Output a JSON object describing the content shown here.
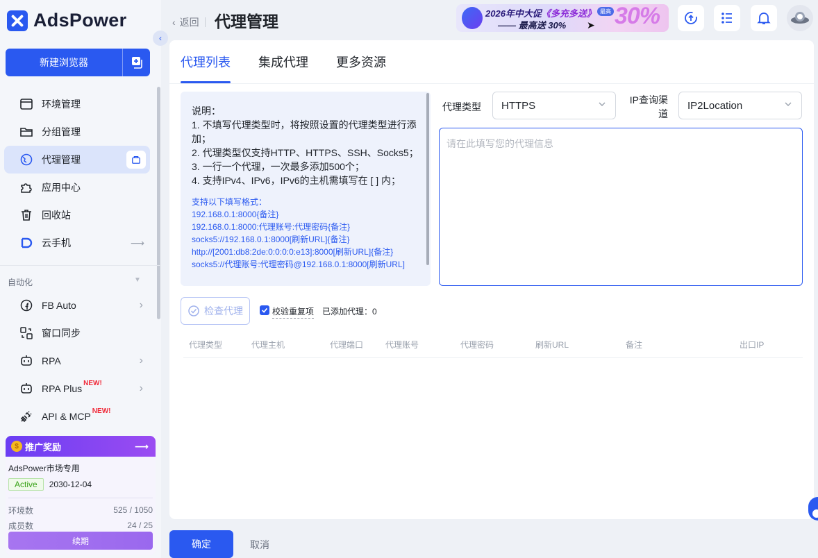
{
  "app": {
    "name": "AdsPower"
  },
  "sidebar": {
    "new_browser": "新建浏览器",
    "items": [
      {
        "label": "环境管理",
        "icon": "browser-window-icon"
      },
      {
        "label": "分组管理",
        "icon": "folder-icon"
      },
      {
        "label": "代理管理",
        "icon": "proxy-globe-icon",
        "active": true
      },
      {
        "label": "应用中心",
        "icon": "puzzle-icon"
      },
      {
        "label": "回收站",
        "icon": "trash-icon"
      },
      {
        "label": "云手机",
        "icon": "cloud-phone-icon"
      }
    ],
    "section": "自动化",
    "auto_items": [
      {
        "label": "FB Auto",
        "icon": "facebook-icon"
      },
      {
        "label": "窗口同步",
        "icon": "sync-icon"
      },
      {
        "label": "RPA",
        "icon": "robot-icon"
      },
      {
        "label": "RPA Plus",
        "icon": "robot-icon",
        "tag": "NEW!"
      },
      {
        "label": "API & MCP",
        "icon": "plug-icon",
        "tag": "NEW!"
      }
    ],
    "promo": {
      "title": "推广奖励",
      "plan": "AdsPower市场专用",
      "status": "Active",
      "expire": "2030-12-04",
      "env_label": "环境数",
      "env_value": "525 / 1050",
      "member_label": "成员数",
      "member_value": "24 / 25",
      "renew": "续期"
    }
  },
  "header": {
    "back": "返回",
    "title": "代理管理",
    "banner": {
      "line1_a": "2026年中大促",
      "line1_b": "《多充多送》",
      "line2": "—— 最高送 30%",
      "badge": "最高",
      "big": "30%"
    }
  },
  "tabs": [
    "代理列表",
    "集成代理",
    "更多资源"
  ],
  "note": {
    "lines": [
      "说明：",
      "1. 不填写代理类型时，将按照设置的代理类型进行添加；",
      "2. 代理类型仅支持HTTP、HTTPS、SSH、Socks5；",
      "3. 一行一个代理，一次最多添加500个；",
      "4. 支持IPv4、IPv6，IPv6的主机需填写在 [ ] 内；"
    ],
    "format_title": "支持以下填写格式：",
    "formats": [
      "192.168.0.1:8000{备注}",
      "192.168.0.1:8000:代理账号:代理密码{备注}",
      "socks5://192.168.0.1:8000[刷新URL]{备注}",
      "http://[2001:db8:2de:0:0:0:0:e13]:8000[刷新URL]{备注}",
      "socks5://代理账号:代理密码@192.168.0.1:8000[刷新URL]"
    ]
  },
  "form": {
    "type_label": "代理类型",
    "type_value": "HTTPS",
    "ipq_label_1": "IP查询渠",
    "ipq_label_2": "道",
    "ipq_value": "IP2Location",
    "placeholder": "请在此填写您的代理信息",
    "check_btn": "检查代理",
    "dedupe": "校验重复项",
    "added_label": "已添加代理：",
    "added_count": "0"
  },
  "table": {
    "columns": [
      "代理类型",
      "代理主机",
      "代理端口",
      "代理账号",
      "代理密码",
      "刷新URL",
      "备注",
      "出口IP"
    ]
  },
  "footer": {
    "ok": "确定",
    "cancel": "取消"
  },
  "colors": {
    "primary": "#2a59f0",
    "active_bg": "#dbe4fb",
    "link": "#2a59f0"
  }
}
